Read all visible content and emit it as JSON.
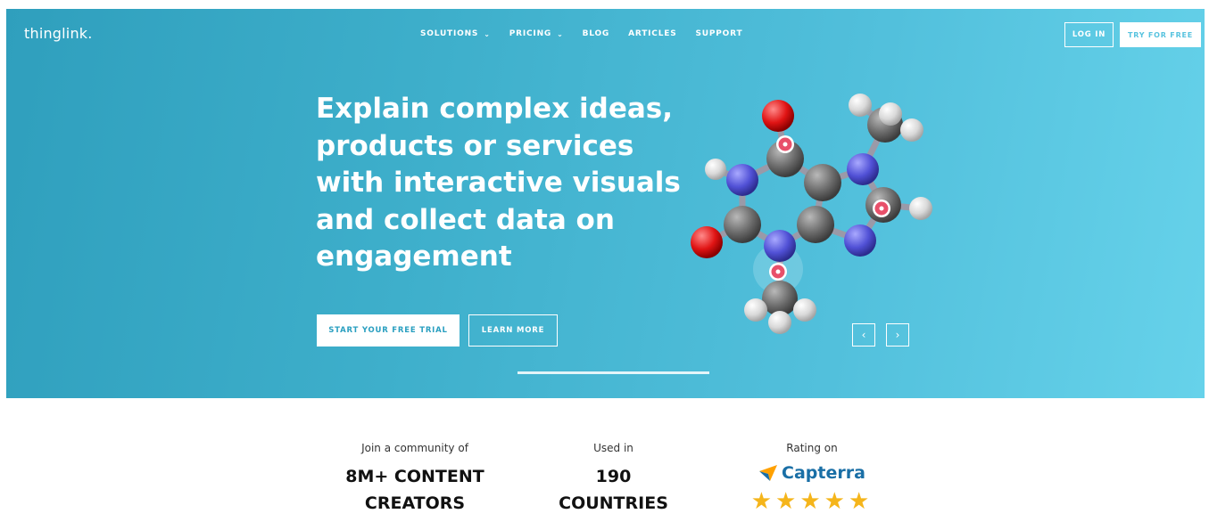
{
  "header": {
    "logo": "thinglink.",
    "nav": [
      {
        "label": "SOLUTIONS",
        "dropdown": true
      },
      {
        "label": "PRICING",
        "dropdown": true
      },
      {
        "label": "BLOG",
        "dropdown": false
      },
      {
        "label": "ARTICLES",
        "dropdown": false
      },
      {
        "label": "SUPPORT",
        "dropdown": false
      }
    ],
    "login_label": "LOG IN",
    "try_label": "TRY FOR FREE"
  },
  "hero": {
    "headline_lines": [
      "Explain complex ideas,",
      "products or services",
      "with interactive visuals",
      "and collect data on",
      "engagement"
    ],
    "start_label": "START YOUR FREE TRIAL",
    "learn_label": "LEARN MORE",
    "prev_icon": "chevron-left-icon",
    "next_icon": "chevron-right-icon",
    "image": "molecule-3d-icon"
  },
  "stats": [
    {
      "label": "Join a community of",
      "value_lines": [
        "8M+ CONTENT",
        "CREATORS"
      ]
    },
    {
      "label": "Used in",
      "value_lines": [
        "190",
        "COUNTRIES"
      ]
    },
    {
      "label": "Rating on",
      "brand": "Capterra",
      "stars": 5
    }
  ],
  "colors": {
    "hero_start": "#2f9fbd",
    "hero_end": "#66d2ea",
    "capterra_blue": "#1a6fa6",
    "star": "#f5b51b",
    "hotspot": "#e8506a"
  }
}
